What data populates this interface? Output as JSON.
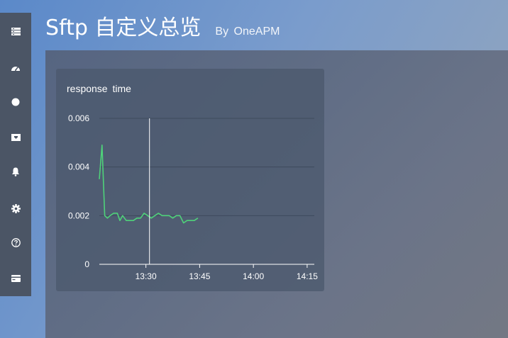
{
  "header": {
    "title": "Sftp 自定义总览",
    "by_label": "By  OneAPM"
  },
  "sidebar": {
    "items": [
      {
        "icon": "list-icon"
      },
      {
        "icon": "dashboard-icon"
      },
      {
        "icon": "circle-icon"
      },
      {
        "icon": "inbox-icon"
      },
      {
        "icon": "bell-icon"
      },
      {
        "icon": "gear-icon"
      },
      {
        "icon": "help-icon"
      },
      {
        "icon": "card-icon"
      }
    ]
  },
  "card": {
    "title": "response  time"
  },
  "chart_data": {
    "type": "line",
    "title": "response  time",
    "x_ticks": [
      "13:30",
      "13:45",
      "14:00",
      "14:15"
    ],
    "y_ticks": [
      "0",
      "0.002",
      "0.004",
      "0.006"
    ],
    "ylim": [
      0,
      0.006
    ],
    "xlim": [
      "13:17",
      "14:17"
    ],
    "grid": true,
    "cursor_time": "13:31",
    "line_color": "#4fd27a",
    "series": [
      {
        "values": [
          [
            "13:17:00",
            0.0035
          ],
          [
            "13:17:45",
            0.0049
          ],
          [
            "13:18:30",
            0.002
          ],
          [
            "13:19:15",
            0.0019
          ],
          [
            "13:20:00",
            0.002
          ],
          [
            "13:21:00",
            0.0021
          ],
          [
            "13:22:00",
            0.0021
          ],
          [
            "13:22:45",
            0.0018
          ],
          [
            "13:23:30",
            0.002
          ],
          [
            "13:24:30",
            0.0018
          ],
          [
            "13:25:30",
            0.0018
          ],
          [
            "13:26:30",
            0.0018
          ],
          [
            "13:27:30",
            0.0019
          ],
          [
            "13:28:30",
            0.0019
          ],
          [
            "13:29:30",
            0.0021
          ],
          [
            "13:30:30",
            0.002
          ],
          [
            "13:31:30",
            0.0019
          ],
          [
            "13:32:30",
            0.002
          ],
          [
            "13:33:30",
            0.0021
          ],
          [
            "13:34:30",
            0.002
          ],
          [
            "13:35:30",
            0.002
          ],
          [
            "13:36:30",
            0.002
          ],
          [
            "13:37:30",
            0.0019
          ],
          [
            "13:38:30",
            0.002
          ],
          [
            "13:39:30",
            0.002
          ],
          [
            "13:40:30",
            0.0017
          ],
          [
            "13:41:30",
            0.0018
          ],
          [
            "13:42:30",
            0.0018
          ],
          [
            "13:43:30",
            0.0018
          ],
          [
            "13:44:30",
            0.0019
          ]
        ]
      }
    ]
  }
}
